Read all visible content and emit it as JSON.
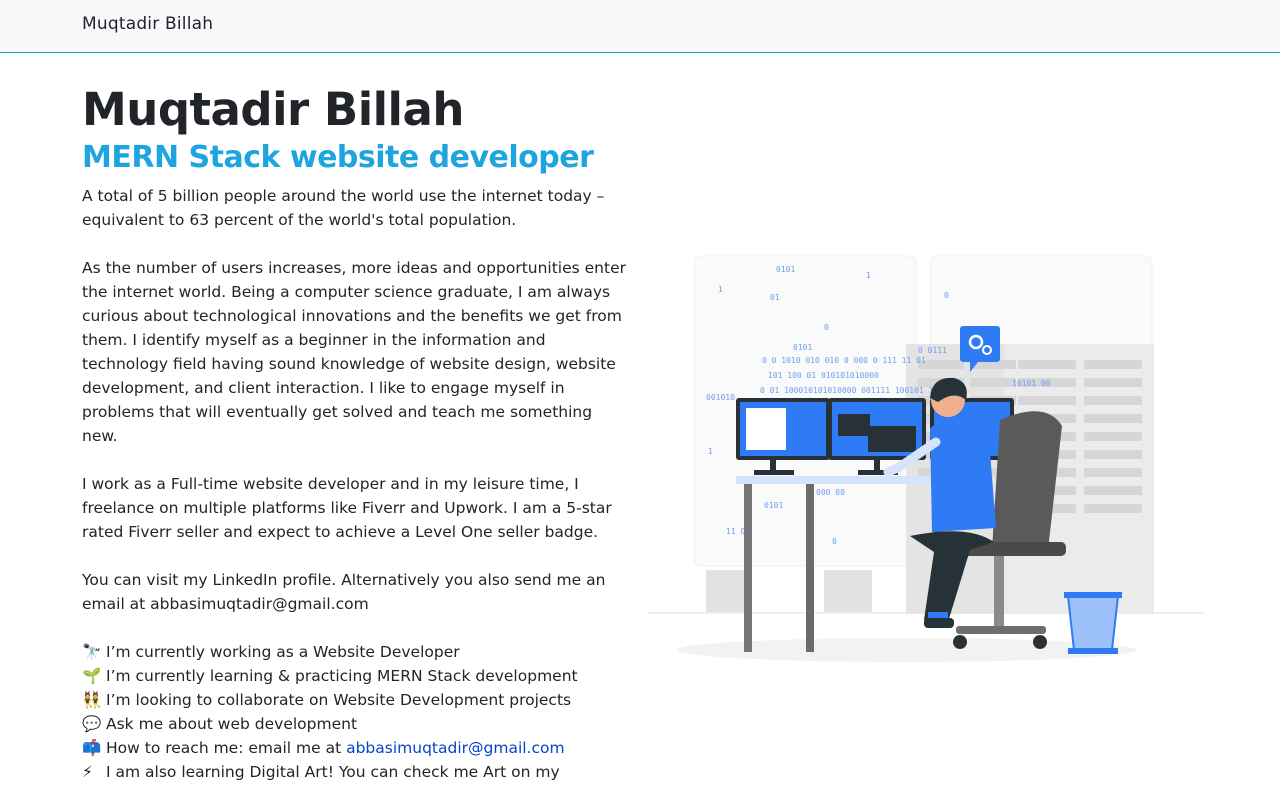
{
  "navbar": {
    "brand": "Muqtadir Billah"
  },
  "hero": {
    "name": "Muqtadir Billah",
    "subtitle": "MERN Stack website developer",
    "paragraphs": [
      "A total of 5 billion people around the world use the internet today – equivalent to 63 percent of the world's total population.",
      "As the number of users increases, more ideas and opportunities enter the internet world. Being a computer science graduate, I am always curious about technological innovations and the benefits we get from them. I identify myself as a beginner in the information and technology field having sound knowledge of website design, website development, and client interaction. I like to engage myself in problems that will eventually get solved and teach me something new.",
      "I work as a Full-time website developer and in my leisure time, I freelance on multiple platforms like Fiverr and Upwork. I am a 5-star rated Fiverr seller and expect to achieve a Level One seller badge.",
      "You can visit my LinkedIn profile. Alternatively you also send me an email at abbasimuqtadir@gmail.com"
    ],
    "list": [
      {
        "icon": "🔭",
        "icon_name": "telescope-icon",
        "text": "I’m currently working as a Website Developer"
      },
      {
        "icon": "🌱",
        "icon_name": "seedling-icon",
        "text": "I’m currently learning & practicing MERN Stack development"
      },
      {
        "icon": "👯",
        "icon_name": "people-icon",
        "text": "I’m looking to collaborate on Website Development projects"
      },
      {
        "icon": "💬",
        "icon_name": "speech-bubble-icon",
        "text": "Ask me about web development"
      },
      {
        "icon": "📫",
        "icon_name": "mailbox-icon",
        "text": "How to reach me: email me at ",
        "link": "abbasimuqtadir@gmail.com"
      },
      {
        "icon": "⚡",
        "icon_name": "lightning-icon",
        "text": "I am also learning Digital Art! You can check me Art on my"
      }
    ]
  },
  "illustration": {
    "name": "developer-at-desk-illustration",
    "binary_snippets": [
      "0101",
      "1",
      "01",
      "0",
      "1",
      "0",
      "0101",
      "0 0 1010 010 010 0 000 0 111 11 01",
      "101 100 01 010101010000",
      "0 01 100010101010000 001111 100101 110",
      "001010",
      "0 0111",
      "10101 00",
      "000 00",
      "0101",
      "11 01",
      "0",
      "1"
    ],
    "colors": {
      "accent": "#2f7bf5",
      "dark": "#263238",
      "grey": "#e0e0e0"
    }
  }
}
